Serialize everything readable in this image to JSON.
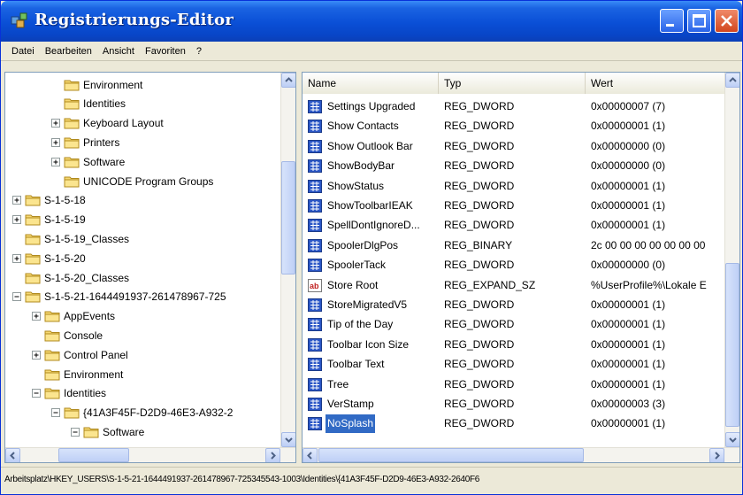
{
  "window": {
    "title": "Registrierungs-Editor"
  },
  "menu": [
    {
      "label": "Datei"
    },
    {
      "label": "Bearbeiten"
    },
    {
      "label": "Ansicht"
    },
    {
      "label": "Favoriten"
    },
    {
      "label": "?"
    }
  ],
  "tree": [
    {
      "label": "Environment",
      "level": 2,
      "expander": "none"
    },
    {
      "label": "Identities",
      "level": 2,
      "expander": "none"
    },
    {
      "label": "Keyboard Layout",
      "level": 2,
      "expander": "plus"
    },
    {
      "label": "Printers",
      "level": 2,
      "expander": "plus"
    },
    {
      "label": "Software",
      "level": 2,
      "expander": "plus"
    },
    {
      "label": "UNICODE Program Groups",
      "level": 2,
      "expander": "none"
    },
    {
      "label": "S-1-5-18",
      "level": 0,
      "expander": "plus"
    },
    {
      "label": "S-1-5-19",
      "level": 0,
      "expander": "plus"
    },
    {
      "label": "S-1-5-19_Classes",
      "level": 0,
      "expander": "none"
    },
    {
      "label": "S-1-5-20",
      "level": 0,
      "expander": "plus"
    },
    {
      "label": "S-1-5-20_Classes",
      "level": 0,
      "expander": "none"
    },
    {
      "label": "S-1-5-21-1644491937-261478967-725",
      "level": 0,
      "expander": "minus"
    },
    {
      "label": "AppEvents",
      "level": 1,
      "expander": "plus"
    },
    {
      "label": "Console",
      "level": 1,
      "expander": "none"
    },
    {
      "label": "Control Panel",
      "level": 1,
      "expander": "plus"
    },
    {
      "label": "Environment",
      "level": 1,
      "expander": "none"
    },
    {
      "label": "Identities",
      "level": 1,
      "expander": "minus"
    },
    {
      "label": "{41A3F45F-D2D9-46E3-A932-2",
      "level": 2,
      "expander": "minus"
    },
    {
      "label": "Software",
      "level": 3,
      "expander": "minus"
    }
  ],
  "list": {
    "columns": [
      "Name",
      "Typ",
      "Wert"
    ],
    "rows": [
      {
        "name": "Settings Upgraded",
        "type": "REG_DWORD",
        "value": "0x00000007 (7)",
        "icon": "dword-icon"
      },
      {
        "name": "Show Contacts",
        "type": "REG_DWORD",
        "value": "0x00000001 (1)",
        "icon": "dword-icon"
      },
      {
        "name": "Show Outlook Bar",
        "type": "REG_DWORD",
        "value": "0x00000000 (0)",
        "icon": "dword-icon"
      },
      {
        "name": "ShowBodyBar",
        "type": "REG_DWORD",
        "value": "0x00000000 (0)",
        "icon": "dword-icon"
      },
      {
        "name": "ShowStatus",
        "type": "REG_DWORD",
        "value": "0x00000001 (1)",
        "icon": "dword-icon"
      },
      {
        "name": "ShowToolbarIEAK",
        "type": "REG_DWORD",
        "value": "0x00000001 (1)",
        "icon": "dword-icon"
      },
      {
        "name": "SpellDontIgnoreD...",
        "type": "REG_DWORD",
        "value": "0x00000001 (1)",
        "icon": "dword-icon"
      },
      {
        "name": "SpoolerDlgPos",
        "type": "REG_BINARY",
        "value": "2c 00 00 00 00 00 00 00",
        "icon": "binary-icon"
      },
      {
        "name": "SpoolerTack",
        "type": "REG_DWORD",
        "value": "0x00000000 (0)",
        "icon": "dword-icon"
      },
      {
        "name": "Store Root",
        "type": "REG_EXPAND_SZ",
        "value": "%UserProfile%\\Lokale E",
        "icon": "string-icon"
      },
      {
        "name": "StoreMigratedV5",
        "type": "REG_DWORD",
        "value": "0x00000001 (1)",
        "icon": "dword-icon"
      },
      {
        "name": "Tip of the Day",
        "type": "REG_DWORD",
        "value": "0x00000001 (1)",
        "icon": "dword-icon"
      },
      {
        "name": "Toolbar Icon Size",
        "type": "REG_DWORD",
        "value": "0x00000001 (1)",
        "icon": "dword-icon"
      },
      {
        "name": "Toolbar Text",
        "type": "REG_DWORD",
        "value": "0x00000001 (1)",
        "icon": "dword-icon"
      },
      {
        "name": "Tree",
        "type": "REG_DWORD",
        "value": "0x00000001 (1)",
        "icon": "dword-icon"
      },
      {
        "name": "VerStamp",
        "type": "REG_DWORD",
        "value": "0x00000003 (3)",
        "icon": "dword-icon"
      },
      {
        "name": "NoSplash",
        "type": "REG_DWORD",
        "value": "0x00000001 (1)",
        "icon": "dword-icon",
        "selected": true
      }
    ]
  },
  "statusbar": {
    "path": "Arbeitsplatz\\HKEY_USERS\\S-1-5-21-1644491937-261478967-725345543-1003\\Identities\\{41A3F45F-D2D9-46E3-A932-2640F6"
  }
}
